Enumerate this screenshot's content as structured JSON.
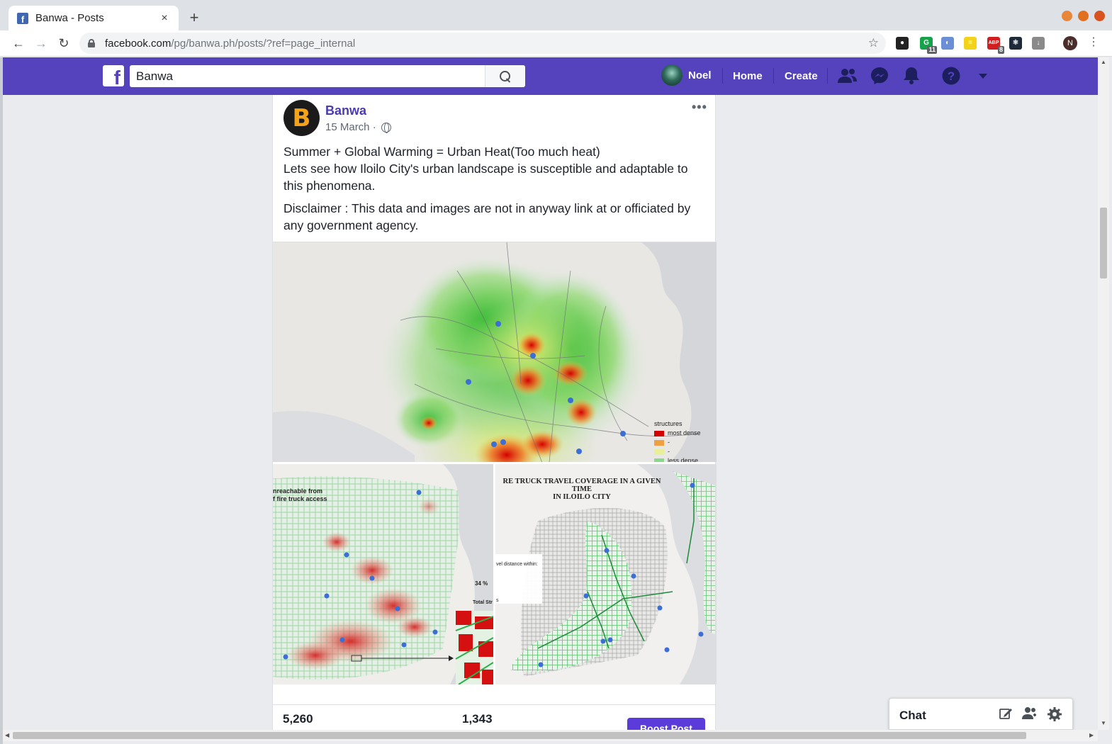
{
  "browser": {
    "tab_title": "Banwa - Posts",
    "tab_close": "×",
    "new_tab": "+",
    "url_host": "facebook.com",
    "url_path": "/pg/banwa.ph/posts/?ref=page_internal",
    "star_icon": "☆",
    "profile_initial": "N",
    "menu": "⋮",
    "extensions": [
      {
        "name": "github-extension-icon",
        "color": "#222222",
        "glyph": "●",
        "badge": ""
      },
      {
        "name": "grammarly-extension-icon",
        "color": "#15a34a",
        "glyph": "G",
        "badge": "11"
      },
      {
        "name": "sync-extension-icon",
        "color": "#6b8fd6",
        "glyph": "◐",
        "badge": ""
      },
      {
        "name": "notes-extension-icon",
        "color": "#f2d21b",
        "glyph": "≡",
        "badge": ""
      },
      {
        "name": "adblock-extension-icon",
        "color": "#d11f1f",
        "glyph": "ABP",
        "badge": "8"
      },
      {
        "name": "react-devtools-extension-icon",
        "color": "#1e2a3a",
        "glyph": "⚛",
        "badge": ""
      },
      {
        "name": "download-extension-icon",
        "color": "#8a8a8a",
        "glyph": "↓",
        "badge": ""
      }
    ],
    "window_controls": [
      "#e8873a",
      "#e0701f",
      "#d9531e"
    ]
  },
  "fb_header": {
    "logo": "f",
    "search_value": "Banwa",
    "user_name": "Noel",
    "home": "Home",
    "create": "Create"
  },
  "post": {
    "page_name": "Banwa",
    "page_initial": "B",
    "date": "15 March ·",
    "more": "•••",
    "text_lines": [
      "Summer + Global Warming = Urban Heat(Too much heat)\nLets see how Iloilo City's urban landscape is susceptible and adaptable to this phenomena.",
      "Disclaimer : This data and images are not in anyway link at or officiated by any government agency."
    ],
    "images": {
      "main_legend": {
        "title": "structures",
        "items": [
          {
            "label": "most dense",
            "color": "#d40000"
          },
          {
            "label": "-",
            "color": "#f0a040"
          },
          {
            "label": "-",
            "color": "#e8ee9a"
          },
          {
            "label": "less dense",
            "color": "#8ad98a"
          }
        ]
      },
      "left_caption_1": "nreachable from",
      "left_caption_2": "f fire truck access",
      "left_pct": "34 %",
      "left_total": "Total Str",
      "right_title_1": "RE TRUCK TRAVEL COVERAGE IN A GIVEN TIME",
      "right_title_2": "IN ILOILO CITY",
      "right_legend": "vel distance within:",
      "right_legend_2": "s"
    },
    "stat_1": "5,260",
    "stat_2": "1,343",
    "boost_label": "Boost Post"
  },
  "chat": {
    "title": "Chat"
  }
}
